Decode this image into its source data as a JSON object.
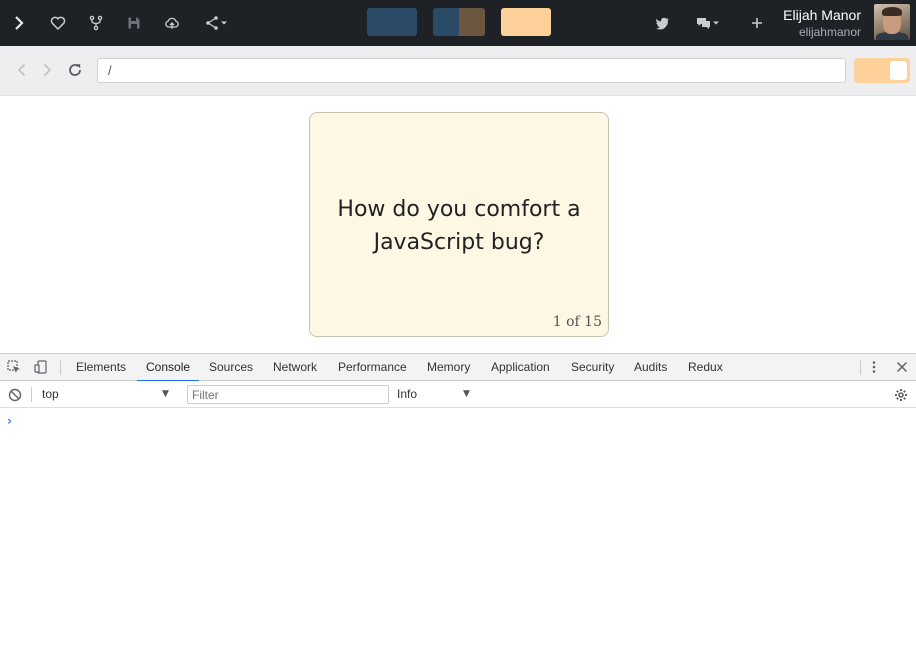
{
  "topbar": {
    "icons": [
      "chevron-right-icon",
      "heart-icon",
      "fork-icon",
      "save-icon",
      "cloud-upload-icon",
      "share-icon",
      "twitter-icon",
      "chat-icon",
      "plus-icon"
    ],
    "swatches": [
      {
        "name": "dark-blue",
        "colors": [
          "#2b4a66"
        ]
      },
      {
        "name": "blue-brown",
        "colors": [
          "#2b4a66",
          "#6b5640"
        ]
      },
      {
        "name": "peach",
        "colors": [
          "#ffd19a"
        ]
      }
    ],
    "user": {
      "name": "Elijah Manor",
      "handle": "elijahmanor"
    }
  },
  "browser": {
    "url": "/",
    "toggle_color": "#ffd19a"
  },
  "card": {
    "question": "How do you comfort a JavaScript bug?",
    "counter": "1 of 15",
    "background": "#fdf7e3"
  },
  "devtools": {
    "tabs": [
      "Elements",
      "Console",
      "Sources",
      "Network",
      "Performance",
      "Memory",
      "Application",
      "Security",
      "Audits",
      "Redux"
    ],
    "active_tab": "Console",
    "context": "top",
    "filter_placeholder": "Filter",
    "level": "Info",
    "prompt": "›"
  }
}
